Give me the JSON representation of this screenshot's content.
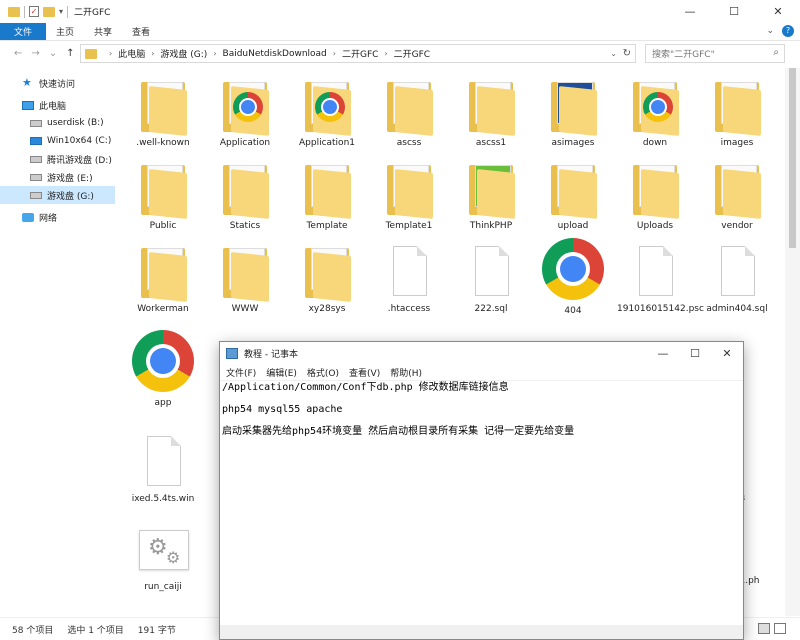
{
  "window": {
    "title": "二开GFC",
    "minimize": "—",
    "maximize": "☐",
    "close": "✕"
  },
  "ribbon": {
    "tabs": [
      "文件",
      "主页",
      "共享",
      "查看"
    ],
    "expand": "⌄",
    "help": "?"
  },
  "nav": {
    "back": "←",
    "forward": "→",
    "recent": "⌄",
    "up": "↑"
  },
  "address": {
    "crumbs": [
      "此电脑",
      "游戏盘 (G:)",
      "BaiduNetdiskDownload",
      "二开GFC",
      "二开GFC"
    ],
    "refresh": "↻"
  },
  "search": {
    "placeholder": "搜索\"二开GFC\"",
    "icon": "🔍"
  },
  "sidebar": {
    "items": [
      {
        "label": "快速访问",
        "icon": "star-icon"
      },
      {
        "label": "此电脑",
        "icon": "computer-icon"
      },
      {
        "label": "userdisk (B:)",
        "icon": "drive-icon"
      },
      {
        "label": "Win10x64 (C:)",
        "icon": "windows-drive-icon"
      },
      {
        "label": "腾讯游戏盘 (D:)",
        "icon": "drive-icon"
      },
      {
        "label": "游戏盘 (E:)",
        "icon": "drive-icon"
      },
      {
        "label": "游戏盘 (G:)",
        "icon": "drive-icon"
      },
      {
        "label": "网络",
        "icon": "network-icon"
      }
    ],
    "selected_index": 6
  },
  "files": [
    {
      "name": ".well-known",
      "type": "folder"
    },
    {
      "name": "Application",
      "type": "folder-chrome"
    },
    {
      "name": "Application1",
      "type": "folder-chrome"
    },
    {
      "name": "ascss",
      "type": "folder"
    },
    {
      "name": "ascss1",
      "type": "folder"
    },
    {
      "name": "asimages",
      "type": "folder-image"
    },
    {
      "name": "down",
      "type": "folder-chrome"
    },
    {
      "name": "images",
      "type": "folder"
    },
    {
      "name": "Public",
      "type": "folder"
    },
    {
      "name": "Statics",
      "type": "folder"
    },
    {
      "name": "Template",
      "type": "folder"
    },
    {
      "name": "Template1",
      "type": "folder"
    },
    {
      "name": "ThinkPHP",
      "type": "folder-green"
    },
    {
      "name": "upload",
      "type": "folder"
    },
    {
      "name": "Uploads",
      "type": "folder"
    },
    {
      "name": "vendor",
      "type": "folder"
    },
    {
      "name": "Workerman",
      "type": "folder"
    },
    {
      "name": "WWW",
      "type": "folder"
    },
    {
      "name": "xy28sys",
      "type": "folder"
    },
    {
      "name": ".htaccess",
      "type": "doc"
    },
    {
      "name": "222.sql",
      "type": "doc"
    },
    {
      "name": "404",
      "type": "chrome"
    },
    {
      "name": "191016015142.psc",
      "type": "doc"
    },
    {
      "name": "admin404.sql",
      "type": "doc"
    },
    {
      "name": "app",
      "type": "chrome"
    },
    {
      "name": "ixed.5.4ts.win",
      "type": "doc"
    },
    {
      "name": "run_caiji",
      "type": "gear"
    }
  ],
  "partial_labels": [
    "_3",
    "_1.ph"
  ],
  "status": {
    "count": "58 个项目",
    "selection": "选中 1 个项目",
    "size": "191 字节"
  },
  "notepad": {
    "title": "教程 - 记事本",
    "menu": [
      "文件(F)",
      "编辑(E)",
      "格式(O)",
      "查看(V)",
      "帮助(H)"
    ],
    "lines": [
      "/Application/Common/Conf下db.php 修改数据库链接信息",
      "",
      "php54 mysql55 apache",
      "",
      "启动采集器先给php54环境变量 然后启动根目录所有采集 记得一定要先给变量"
    ]
  }
}
